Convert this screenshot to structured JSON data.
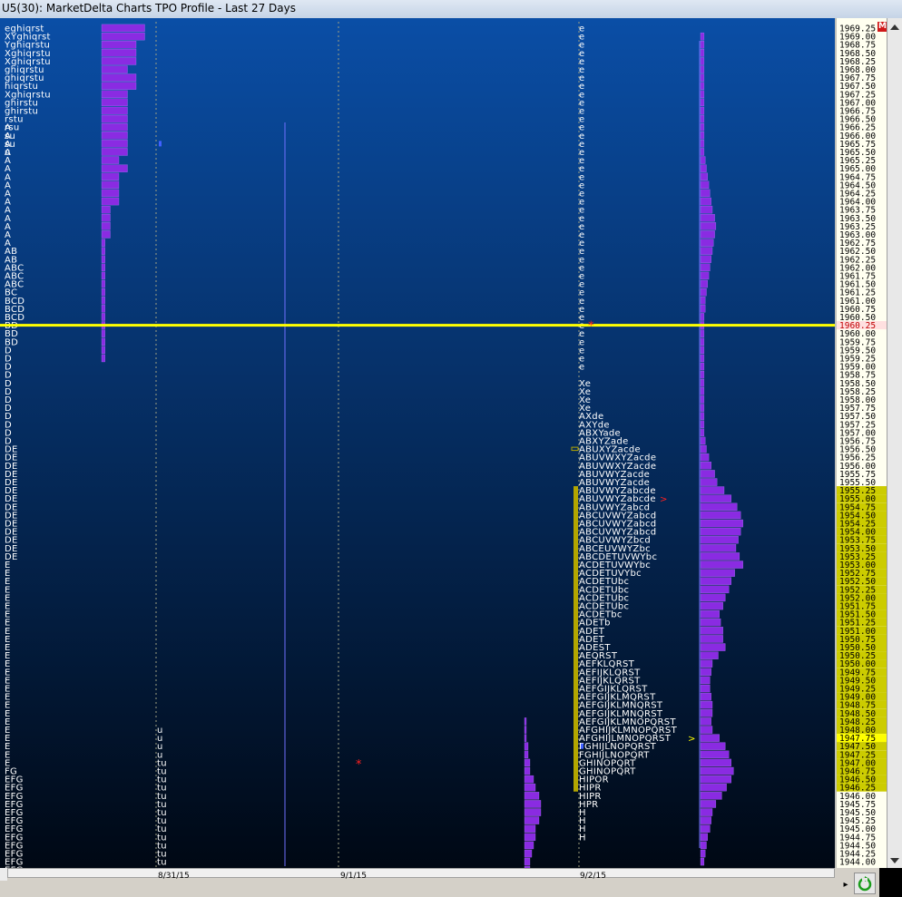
{
  "window": {
    "title": "U5(30): MarketDelta Charts TPO Profile - Last 27 Days"
  },
  "badge": "M",
  "colors": {
    "bg_top": "#0a4ea6",
    "bg_bottom": "#000814",
    "tpo_text": "#ffffff",
    "volume_bar": "#8a2be2",
    "highlight_line": "#ffff00",
    "value_area": "#b3a600",
    "axis_bg": "#fffff0",
    "axis_value_area": "#cccc00",
    "last_price_bg": "#ffe0e0",
    "last_price_text": "#c00000"
  },
  "chart_data": {
    "type": "tpo_profile",
    "title": "MarketDelta Charts TPO Profile - Last 27 Days",
    "price_axis": {
      "top": 1969.25,
      "bottom": 1944.0,
      "tick": 0.25,
      "last_price": 1960.25,
      "value_area_ranges": [
        [
          1954.0,
          1955.25
        ],
        [
          1946.25,
          1953.75
        ]
      ],
      "highlight_price": 1947.75
    },
    "dates": [
      "8/31/15",
      "9/1/15",
      "9/2/15"
    ],
    "profiles": [
      {
        "date": "8/31/15",
        "runs": [
          {
            "top": 1969.25,
            "letters": "eghiqrst"
          },
          {
            "top": 1969.0,
            "letters": "XYghiqrst"
          },
          {
            "top": 1968.75,
            "letters": "Yghiqrstu"
          },
          {
            "top": 1968.5,
            "count": 2,
            "letters": "Xghiqrstu"
          },
          {
            "top": 1968.0,
            "count": 2,
            "letters": "ghiqrstu"
          },
          {
            "top": 1967.5,
            "letters": "hiqrstu"
          },
          {
            "top": 1967.25,
            "letters": "Xghiqrstu"
          },
          {
            "top": 1967.0,
            "count": 2,
            "letters": "ghirstu"
          },
          {
            "top": 1966.5,
            "letters": "rstu"
          },
          {
            "top": 1966.25,
            "letters": "rsu"
          },
          {
            "top": 1966.0,
            "count": 2,
            "letters": "su"
          },
          {
            "top": 1965.5,
            "letters": "u"
          },
          {
            "top": 1966.25,
            "count": 4,
            "letters": "A"
          },
          {
            "top": 1965.25,
            "count": 11,
            "letters": "A"
          },
          {
            "top": 1962.5,
            "count": 2,
            "letters": "AB"
          },
          {
            "top": 1962.0,
            "count": 3,
            "letters": "ABC"
          },
          {
            "top": 1961.25,
            "letters": "BC"
          },
          {
            "top": 1961.0,
            "count": 3,
            "letters": "BCD"
          },
          {
            "top": 1960.25,
            "count": 3,
            "letters": "BD"
          },
          {
            "top": 1959.5,
            "count": 12,
            "letters": "D"
          },
          {
            "top": 1956.5,
            "count": 14,
            "letters": "DE"
          },
          {
            "top": 1953.0,
            "count": 25,
            "letters": "E"
          },
          {
            "top": 1946.75,
            "letters": "FG"
          },
          {
            "top": 1946.5,
            "count": 12,
            "letters": "EFG"
          },
          {
            "top": 1943.5,
            "count": 2,
            "letters": "FG"
          }
        ],
        "volume": [
          5,
          5,
          4,
          4,
          4,
          3,
          4,
          4,
          3,
          3,
          3,
          3,
          3,
          3,
          3,
          3,
          2,
          3,
          2,
          2,
          2,
          2,
          1,
          1,
          1,
          1,
          0.4,
          0.4,
          0.4,
          0.4,
          0.4,
          0.4,
          0.4,
          0.4,
          0.4,
          0.4,
          0.4,
          0.4,
          0.4,
          0.4,
          0.4
        ]
      },
      {
        "date": "9/1/15",
        "runs": [
          {
            "top": 1948.0,
            "count": 4,
            "letters": "u"
          },
          {
            "top": 1947.0,
            "count": 13,
            "letters": "tu"
          }
        ],
        "volume": [
          0.1,
          0.1,
          0.1,
          0.2,
          0.2,
          0.3,
          0.3,
          0.5,
          0.6,
          0.8,
          0.9,
          0.9,
          0.8,
          0.6,
          0.6,
          0.5,
          0.4,
          0.3,
          0.3,
          0.2,
          0.2
        ]
      },
      {
        "date": "9/2/15",
        "runs": [
          {
            "top": 1969.25,
            "count": 36,
            "letters": "e"
          },
          {
            "top": 1960.25,
            "count": 6,
            "letters": "e"
          },
          {
            "top": 1958.5,
            "count": 4,
            "letters": "Xe"
          },
          {
            "top": 1957.5,
            "letters": "AXde"
          },
          {
            "top": 1957.25,
            "letters": "AXYde"
          },
          {
            "top": 1957.0,
            "letters": "ABXYade"
          },
          {
            "top": 1956.75,
            "letters": "ABXYZade"
          },
          {
            "top": 1956.5,
            "letters": "ABUXYZacde"
          },
          {
            "top": 1956.25,
            "letters": "ABUVWXYZacde"
          },
          {
            "top": 1956.0,
            "letters": "ABUVWXYZacde"
          },
          {
            "top": 1955.75,
            "letters": "ABUVWYZacde"
          },
          {
            "top": 1955.5,
            "letters": "ABUVWYZacde"
          },
          {
            "top": 1955.25,
            "letters": "ABUVWYZabcde"
          },
          {
            "top": 1955.0,
            "letters": "ABUVWYZabcde"
          },
          {
            "top": 1954.75,
            "letters": "ABUVWYZabcd"
          },
          {
            "top": 1954.5,
            "letters": "ABCUVWYZabcd"
          },
          {
            "top": 1954.25,
            "letters": "ABCUVWYZabcd"
          },
          {
            "top": 1954.0,
            "letters": "ABCUVWYZabcd"
          },
          {
            "top": 1953.75,
            "letters": "ABCUVWYZbcd"
          },
          {
            "top": 1953.5,
            "letters": "ABCEUVWYZbc"
          },
          {
            "top": 1953.25,
            "letters": "ABCDETUVWYbc"
          },
          {
            "top": 1953.0,
            "letters": "ACDETUVWYbc"
          },
          {
            "top": 1952.75,
            "letters": "ACDETUVYbc"
          },
          {
            "top": 1952.5,
            "letters": "ACDETUbc"
          },
          {
            "top": 1952.25,
            "count": 3,
            "letters": "ACDETUbc"
          },
          {
            "top": 1951.5,
            "letters": "ACDETbc"
          },
          {
            "top": 1951.25,
            "letters": "ADETb"
          },
          {
            "top": 1951.0,
            "count": 2,
            "letters": "ADET"
          },
          {
            "top": 1950.5,
            "letters": "ADEST"
          },
          {
            "top": 1950.25,
            "letters": "AEQRST"
          },
          {
            "top": 1950.0,
            "letters": "AEFKLQRST"
          },
          {
            "top": 1949.75,
            "letters": "AEFIJKLQRST"
          },
          {
            "top": 1949.5,
            "letters": "AEFIJKLQRST"
          },
          {
            "top": 1949.25,
            "letters": "AEFGIJKLQRST"
          },
          {
            "top": 1949.0,
            "letters": "AEFGIJKLMQRST"
          },
          {
            "top": 1948.75,
            "letters": "AEFGIJKLMNQRST"
          },
          {
            "top": 1948.5,
            "letters": "AEFGIJKLMNQRST"
          },
          {
            "top": 1948.25,
            "letters": "AEFGIJKLMNOPQRST"
          },
          {
            "top": 1948.0,
            "letters": "AFGHIJKLMNOPQRST"
          },
          {
            "top": 1947.75,
            "letters": "AFGHIJLMNOPQRST"
          },
          {
            "top": 1947.5,
            "letters": "FGHIJLNOPQRST"
          },
          {
            "top": 1947.25,
            "letters": "FGHIJLNOPQRT"
          },
          {
            "top": 1947.0,
            "letters": "GHINOPQRT"
          },
          {
            "top": 1946.75,
            "letters": "GHINOPQRT"
          },
          {
            "top": 1946.5,
            "letters": "HIPOR"
          },
          {
            "top": 1946.25,
            "count": 2,
            "letters": "HIPR"
          },
          {
            "top": 1945.75,
            "letters": "HPR"
          },
          {
            "top": 1945.5,
            "count": 4,
            "letters": "H"
          }
        ],
        "volume": [
          0.3,
          0.3,
          0.3,
          0.3,
          0.3,
          0.3,
          0.3,
          0.3,
          0.3,
          0.3,
          0.3,
          0.3,
          0.3,
          0.3,
          0.3,
          0.4,
          0.5,
          0.6,
          0.7,
          0.8,
          0.9,
          1,
          1.2,
          1.3,
          1.2,
          1.1,
          1,
          0.9,
          0.8,
          0.7,
          0.6,
          0.5,
          0.4,
          0.4,
          0.3,
          0.3,
          0.3,
          0.3,
          0.3,
          0.3,
          0.3,
          0.3,
          0.3,
          0.3,
          0.3,
          0.3,
          0.3,
          0.3,
          0.3,
          0.4,
          0.5,
          0.7,
          0.9,
          1.2,
          1.4,
          2,
          2.6,
          3.1,
          3.4,
          3.6,
          3.4,
          3.2,
          3.0,
          3.3,
          3.6,
          2.9,
          2.6,
          2.4,
          2.1,
          1.9,
          1.6,
          1.7,
          1.9,
          1.9,
          2.1,
          1.5,
          1.0,
          0.9,
          0.8,
          0.8,
          0.9,
          1.0,
          1.0,
          0.9,
          1.0,
          1.6,
          2.1,
          2.4,
          2.6,
          2.8,
          2.6,
          2.2,
          1.8,
          1.3,
          1.0,
          0.9,
          0.8,
          0.6,
          0.5,
          0.4,
          0.3
        ]
      }
    ]
  }
}
